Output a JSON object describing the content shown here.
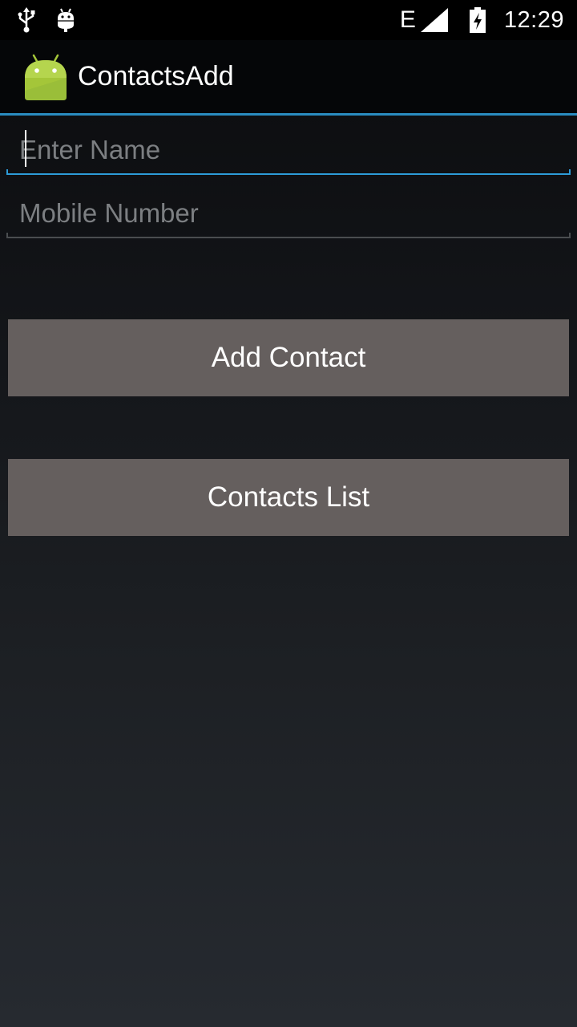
{
  "status_bar": {
    "left_icons": [
      "usb-icon",
      "debug-icon"
    ],
    "network_type": "E",
    "right_icons": [
      "signal-icon",
      "battery-charging-icon"
    ],
    "time": "12:29"
  },
  "action_bar": {
    "icon": "android-icon",
    "title": "ContactsAdd"
  },
  "form": {
    "name_field": {
      "placeholder": "Enter Name",
      "value": ""
    },
    "mobile_field": {
      "placeholder": "Mobile Number",
      "value": ""
    }
  },
  "buttons": {
    "add_contact": "Add Contact",
    "contacts_list": "Contacts List"
  },
  "colors": {
    "accent": "#2d9bd8",
    "button_bg": "#655f5e",
    "android_green": "#a4c639"
  }
}
